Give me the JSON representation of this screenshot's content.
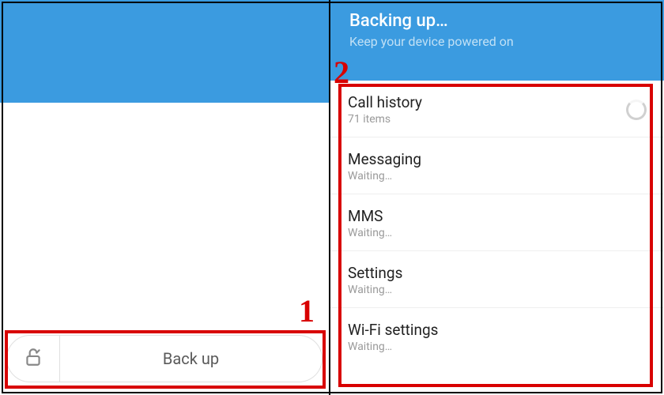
{
  "left": {
    "backup_button_label": "Back up"
  },
  "right": {
    "header_title": "Backing up…",
    "header_subtitle": "Keep your device powered on",
    "items": [
      {
        "title": "Call history",
        "subtitle": "71 items",
        "status": "loading"
      },
      {
        "title": "Messaging",
        "subtitle": "Waiting…",
        "status": "waiting"
      },
      {
        "title": "MMS",
        "subtitle": "Waiting…",
        "status": "waiting"
      },
      {
        "title": "Settings",
        "subtitle": "Waiting…",
        "status": "waiting"
      },
      {
        "title": "Wi-Fi settings",
        "subtitle": "Waiting…",
        "status": "waiting"
      }
    ]
  },
  "annotations": {
    "num1": "1",
    "num2": "2"
  }
}
